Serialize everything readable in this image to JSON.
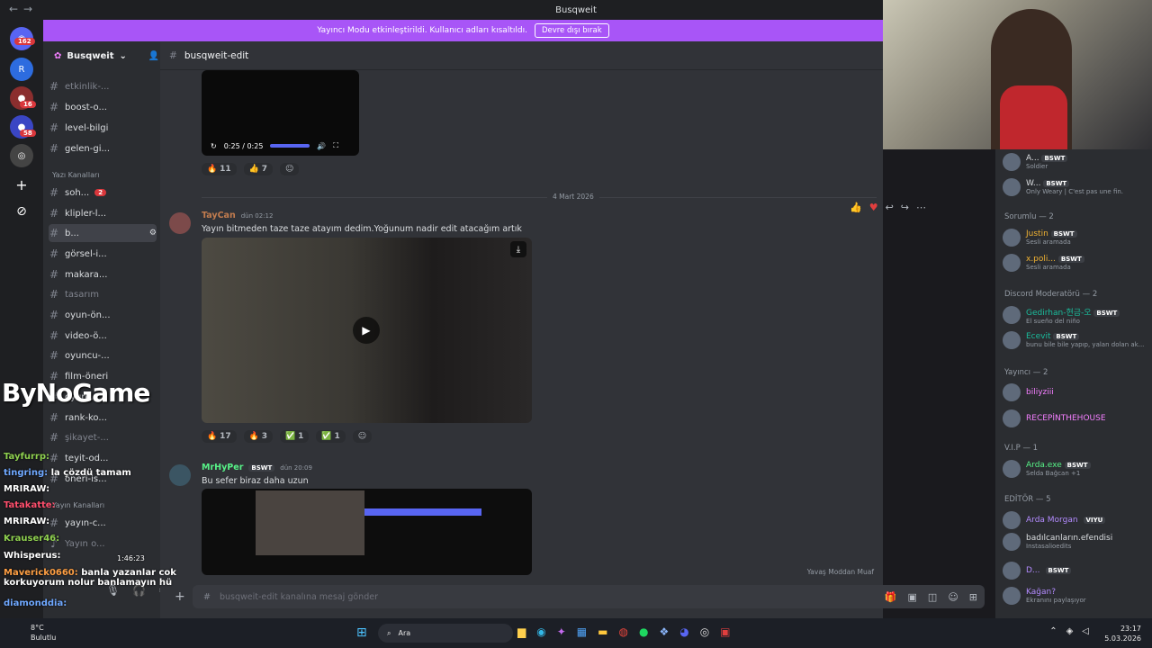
{
  "window": {
    "title": "Busqweit"
  },
  "banner": {
    "text": "Yayıncı Modu etkinleştirildi. Kullanıcı adları kısaltıldı.",
    "button": "Devre dışı bırak"
  },
  "servers": {
    "badges": [
      "162",
      "16",
      "58"
    ]
  },
  "guild": {
    "name": "Busqweit"
  },
  "channels": [
    {
      "name": "etkinlik-...",
      "dim": true
    },
    {
      "name": "boost-o..."
    },
    {
      "name": "level-bilgi"
    },
    {
      "name": "gelen-gi..."
    },
    {
      "name": "soh...",
      "badge": "2"
    },
    {
      "name": "klipler-l..."
    },
    {
      "name": "b...",
      "active": true
    },
    {
      "name": "görsel-i..."
    },
    {
      "name": "makara..."
    },
    {
      "name": "tasarım",
      "dim": true
    },
    {
      "name": "oyun-ön..."
    },
    {
      "name": "video-ö..."
    },
    {
      "name": "oyuncu-..."
    },
    {
      "name": "film-öneri"
    },
    {
      "name": "oyun-..."
    },
    {
      "name": "rank-ko..."
    },
    {
      "name": "şikayet-..."
    },
    {
      "name": "teyit-od..."
    },
    {
      "name": "öneri-is..."
    },
    {
      "name": "yayın-c..."
    },
    {
      "name": "Yayın o...",
      "dim": true
    }
  ],
  "categories": {
    "text": "Yazı Kanalları",
    "voice": "Yayın Kanalları"
  },
  "channel_header": {
    "name": "busqweit-edit"
  },
  "video1": {
    "time": "0:25 / 0:25",
    "progress": 1.0
  },
  "reactions1": [
    {
      "emoji": "🔥",
      "count": "11"
    },
    {
      "emoji": "👍",
      "count": "7"
    }
  ],
  "date_divider": "4 Mart 2026",
  "msg1": {
    "author": "TayCan",
    "time": "dün 02:12",
    "text": "Yayın bitmeden taze taze atayım dedim.Yoğunum nadir edit atacağım artık"
  },
  "reactions2": [
    {
      "emoji": "🔥",
      "count": "17"
    },
    {
      "emoji": "🔥",
      "count": "3"
    },
    {
      "emoji": "✅",
      "count": "1"
    },
    {
      "emoji": "✅",
      "count": "1"
    }
  ],
  "msg2": {
    "author": "MrHyPer",
    "tag": "BSWT",
    "time": "dün 20:09",
    "text": "Bu sefer biraz daha uzun"
  },
  "composer": {
    "placeholder": "busqweit-edit kanalına mesaj gönder",
    "slowmode": "Yavaş Moddan Muaf"
  },
  "members": {
    "top": [
      {
        "name": "A...",
        "sub": "Soldier"
      },
      {
        "name": "W...",
        "sub": "Only Weary | C'est pas une fin."
      }
    ],
    "roles": [
      {
        "title": "Sorumlu — 2",
        "users": [
          {
            "name": "Justin",
            "sub": "Sesli aramada"
          },
          {
            "name": "x.poli...",
            "sub": "Sesli aramada"
          }
        ]
      },
      {
        "title": "Discord Moderatörü — 2",
        "users": [
          {
            "name": "Gedirhan-현금-오",
            "sub": "El sueño del niño"
          },
          {
            "name": "Ecevit",
            "sub": "bunu bile bile yapıp, yalan dolan ak..."
          }
        ]
      },
      {
        "title": "Yayıncı — 2",
        "users": [
          {
            "name": "biliyziii",
            "sub": ""
          },
          {
            "name": "RECEPİNTHEHOUSE",
            "sub": ""
          }
        ]
      },
      {
        "title": "V.I.P — 1",
        "users": [
          {
            "name": "Arda.exe",
            "sub": "Selda Bağcan +1"
          }
        ]
      },
      {
        "title": "EDİTÖR — 5",
        "users": [
          {
            "name": "Arda Morgan",
            "sub": ""
          },
          {
            "name": "badılcanların.efendisi",
            "sub": "Instasalioedits"
          },
          {
            "name": "D...",
            "sub": ""
          },
          {
            "name": "Kağan?",
            "sub": "Ekranını paylaşıyor"
          }
        ]
      }
    ],
    "tag": "BSWT",
    "viyu": "VIYU"
  },
  "overlay": {
    "logo": "ByNoGame",
    "chat": [
      {
        "user": "Tayfurrp:",
        "text": ""
      },
      {
        "user": "tingring:",
        "text": "la çözdü tamam"
      },
      {
        "user": "MRIRAW:",
        "text": ""
      },
      {
        "user": "Tatakatte:",
        "text": ""
      },
      {
        "user": "MRIRAW:",
        "text": ""
      },
      {
        "user": "Krauser46:",
        "text": ""
      },
      {
        "user": "Whisperus:",
        "text": ""
      },
      {
        "user": "Maverick0660:",
        "text": "banla yazanlar cok korkuyorum nolur banlamayın hü"
      },
      {
        "user": "diamonddia:",
        "text": ""
      }
    ],
    "timer": "1:46:23"
  },
  "taskbar": {
    "weather_temp": "8°C",
    "weather_text": "Bulutlu",
    "search": "Ara",
    "time": "23:17",
    "date": "5.03.2026"
  }
}
